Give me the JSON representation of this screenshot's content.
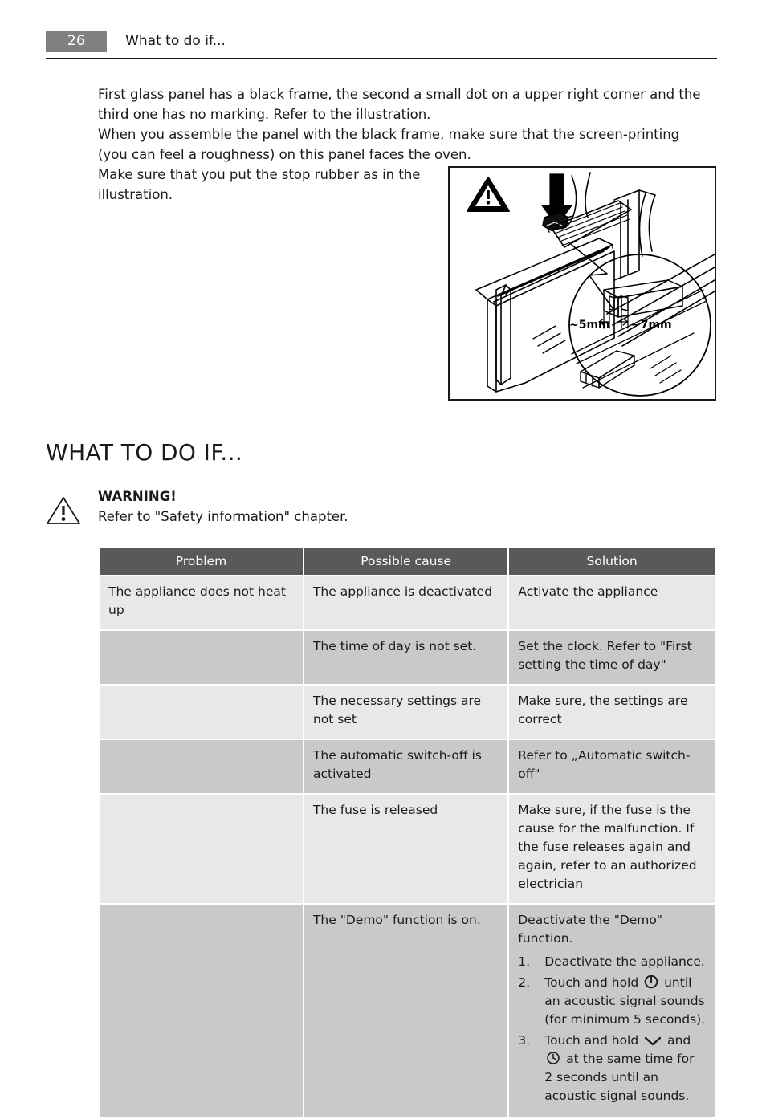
{
  "header": {
    "page_number": "26",
    "title": "What to do if..."
  },
  "intro": {
    "paragraph_1": "First glass panel has a black frame, the second a small dot on a upper right corner and the third one has no marking. Refer to the illustration.",
    "paragraph_2": "When you assemble the panel with the black frame, make sure that the screen-printing (you can feel a roughness) on this panel faces the oven.",
    "paragraph_3": "Make sure that you put the stop rubber as in the illustration."
  },
  "illustration": {
    "name": "oven-door-glass-panel-stop-rubber-diagram",
    "label_left": "~5mm",
    "label_right": "~7mm"
  },
  "section": {
    "heading": "WHAT TO DO IF..."
  },
  "warning": {
    "icon": "warning-triangle-icon",
    "title": "WARNING!",
    "body": "Refer to \"Safety information\" chapter."
  },
  "table": {
    "columns": [
      "Problem",
      "Possible cause",
      "Solution"
    ],
    "rows": [
      {
        "shade": "light",
        "problem": "The appliance does not heat up",
        "cause": "The appliance is deactivated",
        "solution": "Activate the appliance"
      },
      {
        "shade": "dark",
        "problem": "",
        "cause": "The time of day is not set.",
        "solution": "Set the clock. Refer to \"First setting the time of day\""
      },
      {
        "shade": "light",
        "problem": "",
        "cause": "The necessary settings are not set",
        "solution": "Make sure, the settings are correct"
      },
      {
        "shade": "dark",
        "problem": "",
        "cause": "The automatic switch-off is activated",
        "solution": "Refer to „Automatic switch-off\""
      },
      {
        "shade": "light",
        "problem": "",
        "cause": "The fuse is released",
        "solution": "Make sure, if the fuse is the cause for the malfunction. If the fuse releases again and again, refer to an authorized electrician"
      },
      {
        "shade": "dark",
        "problem": "",
        "cause": "The \"Demo\" function is on.",
        "solution_intro": "Deactivate the \"Demo\" function.",
        "steps": [
          {
            "number": "1.",
            "text_before": "Deactivate the appliance.",
            "icon": "",
            "text_after": ""
          },
          {
            "number": "2.",
            "text_before": "Touch and hold",
            "icon": "power-icon",
            "text_after": "until an acoustic signal sounds (for minimum 5 seconds)."
          },
          {
            "number": "3.",
            "text_before": "Touch and hold",
            "icon": "chevron-down-icon",
            "text_middle": "and",
            "icon_2": "clock-icon",
            "text_after": "at the same time for 2 seconds until an acoustic signal sounds."
          }
        ]
      }
    ]
  },
  "colors": {
    "page_number_bg": "#808080",
    "table_header_bg": "#595959",
    "row_light": "#e8e8e8",
    "row_dark": "#c9c9c9",
    "text": "#1a1a1a"
  }
}
